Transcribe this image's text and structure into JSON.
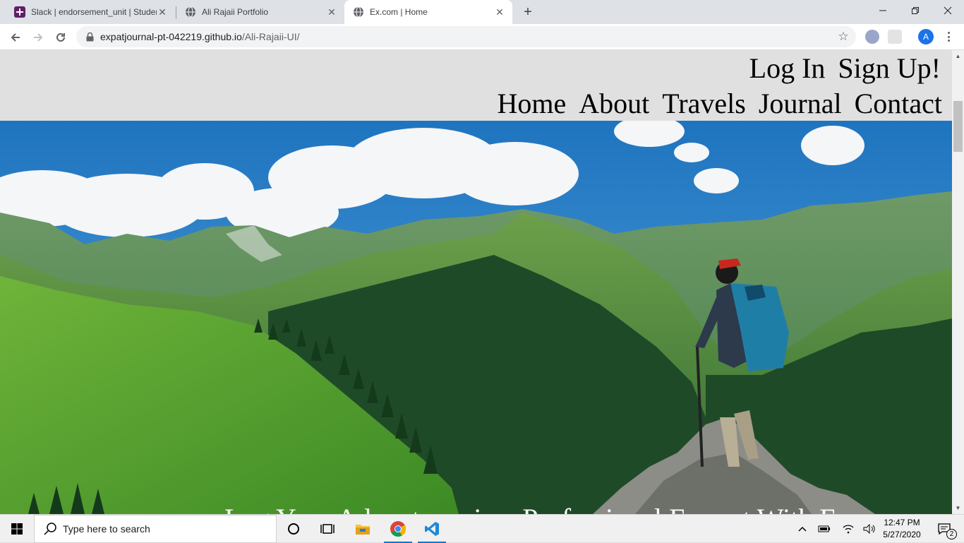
{
  "browser": {
    "tabs": [
      {
        "title": "Slack | endorsement_unit | Student",
        "favicon": "slack-icon"
      },
      {
        "title": "Ali Rajaii Portfolio",
        "favicon": "globe-icon"
      },
      {
        "title": "Ex.com | Home",
        "favicon": "globe-icon",
        "active": true
      }
    ],
    "url_host": "expatjournal-pt-042219.github.io",
    "url_path": "/Ali-Rajaii-UI/",
    "profile_initial": "A"
  },
  "site": {
    "auth_links": [
      "Log In",
      "Sign Up!"
    ],
    "nav_links": [
      "Home",
      "About",
      "Travels",
      "Journal",
      "Contact"
    ],
    "hero_tagline": "Log Your Adventures in a Professional Format With Ex"
  },
  "taskbar": {
    "search_placeholder": "Type here to search",
    "time": "12:47 PM",
    "date": "5/27/2020",
    "notification_count": "2"
  },
  "colors": {
    "header_bg": "#e0e0e0",
    "sky": "#2f86c9",
    "accent": "#1a73e8"
  }
}
